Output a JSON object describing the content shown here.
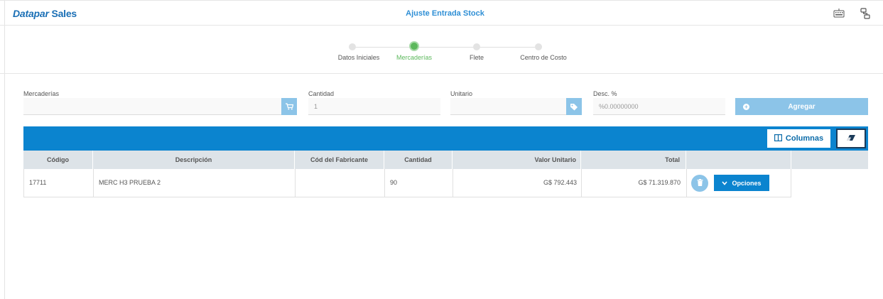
{
  "header": {
    "brand_part1": "Datapar",
    "brand_part2": "Sales",
    "title": "Ajuste Entrada Stock",
    "icons": [
      "keyboard-icon",
      "network-icon"
    ]
  },
  "stepper": {
    "steps": [
      {
        "label": "Datos Iniciales",
        "state": "inactive"
      },
      {
        "label": "Mercaderías",
        "state": "active"
      },
      {
        "label": "Flete",
        "state": "inactive"
      },
      {
        "label": "Centro de Costo",
        "state": "inactive"
      }
    ]
  },
  "form": {
    "mercaderias": {
      "label": "Mercaderías",
      "value": "",
      "icon": "cart-icon"
    },
    "cantidad": {
      "label": "Cantidad",
      "placeholder": "1"
    },
    "unitario": {
      "label": "Unitario",
      "value": "",
      "icon": "tag-icon"
    },
    "desc": {
      "label": "Desc. %",
      "placeholder": "%0.00000000"
    },
    "add_label": "Agregar"
  },
  "toolbar": {
    "columns_label": "Columnas",
    "columns_icon": "columns-icon",
    "clear_icon": "eraser-icon"
  },
  "table": {
    "headers": [
      "Código",
      "Descripción",
      "Cód del Fabricante",
      "Cantidad",
      "Valor Unitario",
      "Total"
    ],
    "rows": [
      {
        "codigo": "17711",
        "descripcion": "MERC H3 PRUEBA 2",
        "cod_fabricante": "",
        "cantidad": "90",
        "valor_unitario": "G$ 792.443",
        "total": "G$ 71.319.870",
        "options_label": "Opciones"
      }
    ]
  },
  "colors": {
    "brand": "#1a6fb5",
    "accent": "#0b84cf",
    "accent_light": "#8cc4e8",
    "step_active": "#5cb85c"
  }
}
